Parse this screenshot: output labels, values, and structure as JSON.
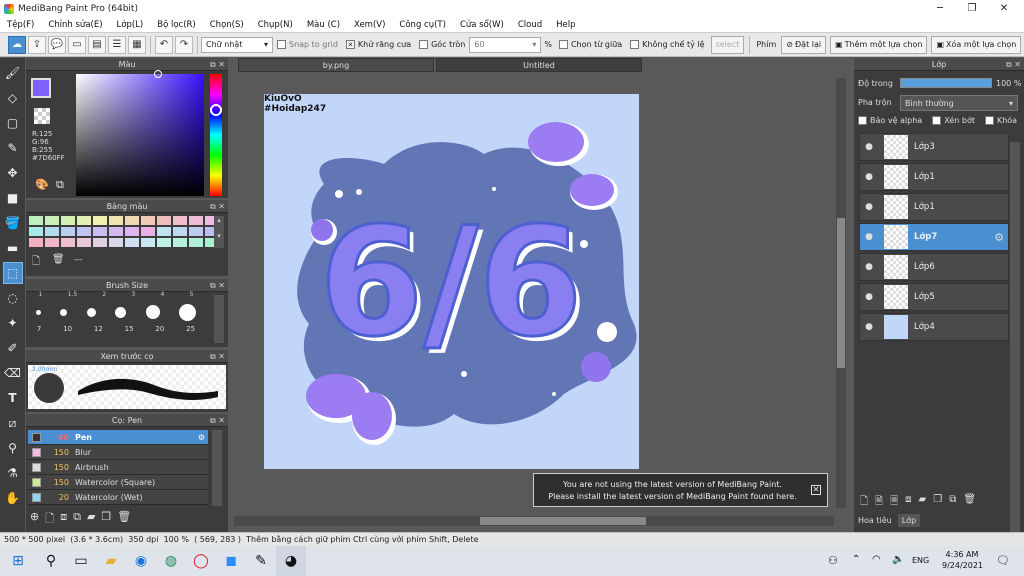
{
  "window": {
    "title": "MediBang Paint Pro (64bit)"
  },
  "menu": [
    "Tệp(F)",
    "Chỉnh sửa(E)",
    "Lớp(L)",
    "Bộ lọc(R)",
    "Chọn(S)",
    "Chụp(N)",
    "Màu (C)",
    "Xem(V)",
    "Công cụ(T)",
    "Cửa sổ(W)",
    "Cloud",
    "Help"
  ],
  "toolbar": {
    "shape_select": "Chữ nhật",
    "snap_to_grid": "Snap to grid",
    "antialias": "Khử răng cưa",
    "corner": "Góc tròn",
    "corner_value": "60",
    "percent": "%",
    "select_from_center": "Chọn từ giữa",
    "fixed_ratio": "Không chế tỷ lệ",
    "select_btn": "select",
    "key_label": "Phím",
    "reset": "Đặt lại",
    "add_selection": "Thêm một lựa chọn",
    "remove_selection": "Xóa một lựa chọn"
  },
  "color_panel": {
    "title": "Màu",
    "r": "R:125",
    "g": "G:96",
    "b": "B:255",
    "hex": "#7D60FF",
    "fg": "#7D60FF",
    "bg": "#FFFFFF"
  },
  "palette_panel": {
    "title": "Bảng màu",
    "more": "---",
    "swatches": [
      "#bdf0bd",
      "#c9f0b8",
      "#d6f0b4",
      "#e4f0b0",
      "#f0f0b0",
      "#f0e4b0",
      "#f0d8b4",
      "#f0cbb8",
      "#f0bdbd",
      "#f0bdcb",
      "#f0bdd8",
      "#f0bde4",
      "#a8e8e8",
      "#b0dcf0",
      "#b8d0f0",
      "#c0c4f0",
      "#c8bcf0",
      "#d4b8f0",
      "#e0b4f0",
      "#ecb0e8",
      "#bde4f0",
      "#bdd8f0",
      "#bdcbf0",
      "#bdbdf0",
      "#f0b0c0",
      "#f0b8c8",
      "#f0c0d0",
      "#e8c8d8",
      "#e0d0e0",
      "#d8d8e8",
      "#d0e0f0",
      "#c8e8f0",
      "#c0f0e8",
      "#b8f0e0",
      "#b0f0d8",
      "#a8f0d0"
    ]
  },
  "brush_size_panel": {
    "title": "Brush Size",
    "top_labels": [
      "1",
      "1.5",
      "2",
      "3",
      "4",
      "5"
    ],
    "labels": [
      "7",
      "10",
      "12",
      "15",
      "20",
      "25"
    ]
  },
  "brush_preview_panel": {
    "title": "Xem trước cọ",
    "size": "2.00mm"
  },
  "brush_list_panel": {
    "title": "Cọ: Pen",
    "items": [
      {
        "size": "40",
        "name": "Pen",
        "color": "#333333",
        "active": true
      },
      {
        "size": "150",
        "name": "Blur",
        "color": "#f8b8e8",
        "active": false
      },
      {
        "size": "150",
        "name": "Airbrush",
        "color": "#dddddd",
        "active": false
      },
      {
        "size": "150",
        "name": "Watercolor (Square)",
        "color": "#c8f08c",
        "active": false
      },
      {
        "size": "20",
        "name": "Watercolor (Wet)",
        "color": "#8cd8f8",
        "active": false
      }
    ]
  },
  "tabs": [
    "by.png",
    "Untitled"
  ],
  "artwork": {
    "watermark_line1": "KiuOvO",
    "watermark_line2": "#Hoidap247",
    "main_text": "6/6"
  },
  "notice": {
    "line1": "You are not using the latest version of MediBang Paint.",
    "line2": "Please install the latest version of MediBang Paint found here.",
    "close": "✕"
  },
  "layer_panel": {
    "title": "Lớp",
    "opacity_label": "Độ trong",
    "opacity_value": "100 %",
    "opacity_fraction": 1.0,
    "blend_label": "Pha trộn",
    "blend_value": "Bình thường",
    "protect_alpha": "Bảo vệ alpha",
    "clipping": "Xén bớt",
    "lock": "Khóa",
    "layers": [
      {
        "name": "Lớp3",
        "active": false
      },
      {
        "name": "Lớp1",
        "active": false
      },
      {
        "name": "Lớp1",
        "active": false
      },
      {
        "name": "Lớp7",
        "active": true
      },
      {
        "name": "Lớp6",
        "active": false
      },
      {
        "name": "Lớp5",
        "active": false
      },
      {
        "name": "Lớp4",
        "active": false
      }
    ],
    "bottom_tabs": [
      "Hoa tiêu",
      "Lớp"
    ]
  },
  "statusbar": {
    "size": "500 * 500 pixel",
    "cm": "(3.6 * 3.6cm)",
    "dpi": "350 dpi",
    "zoom": "100 %",
    "cursor": "( 569, 283 )",
    "hint": "Thêm bằng cách giữ phím Ctrl cùng với phím Shift, Delete"
  },
  "taskbar": {
    "lang": "ENG",
    "time": "4:36 AM",
    "date": "9/24/2021"
  }
}
